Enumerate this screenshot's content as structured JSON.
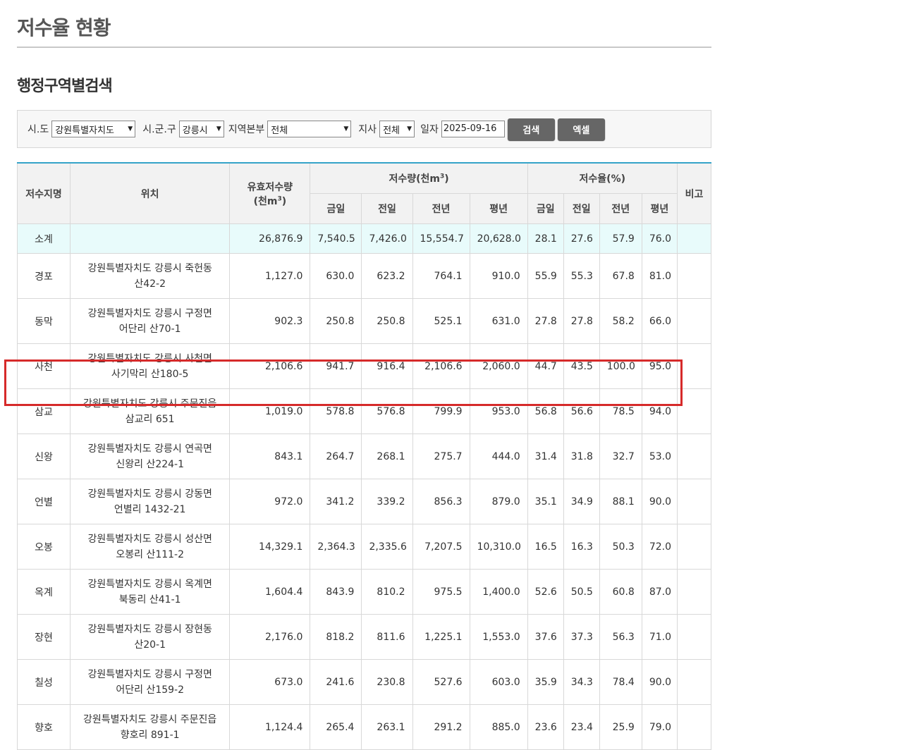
{
  "page_title": "저수율 현황",
  "section_title": "행정구역별검색",
  "search": {
    "sido_label": "시.도",
    "sido_value": "강원특별자치도",
    "sigungu_label": "시.군.구",
    "sigungu_value": "강릉시",
    "region_label": "지역본부",
    "region_value": "전체",
    "branch_label": "지사",
    "branch_value": "전체",
    "date_label": "일자",
    "date_value": "2025-09-16",
    "search_button": "검색",
    "excel_button": "엑셀"
  },
  "table": {
    "headers": {
      "name": "저수지명",
      "location": "위치",
      "effective_a": "유효저수량",
      "effective_b": "(천m",
      "effective_sup": "3",
      "effective_c": ")",
      "storage_a": "저수량(천m",
      "storage_sup": "3",
      "storage_c": ")",
      "rate": "저수율(%)",
      "remark": "비고",
      "today": "금일",
      "prev_day": "전일",
      "prev_year": "전년",
      "avg_year": "평년"
    },
    "summary": {
      "name": "소계",
      "location": "",
      "effective": "26,876.9",
      "s_today": "7,540.5",
      "s_prev_day": "7,426.0",
      "s_prev_year": "15,554.7",
      "s_avg": "20,628.0",
      "r_today": "28.1",
      "r_prev_day": "27.6",
      "r_prev_year": "57.9",
      "r_avg": "76.0",
      "remark": ""
    },
    "rows": [
      {
        "name": "경포",
        "loc1": "강원특별자치도 강릉시 죽헌동",
        "loc2": "산42-2",
        "effective": "1,127.0",
        "s_today": "630.0",
        "s_prev_day": "623.2",
        "s_prev_year": "764.1",
        "s_avg": "910.0",
        "r_today": "55.9",
        "r_prev_day": "55.3",
        "r_prev_year": "67.8",
        "r_avg": "81.0"
      },
      {
        "name": "동막",
        "loc1": "강원특별자치도 강릉시 구정면",
        "loc2": "어단리 산70-1",
        "effective": "902.3",
        "s_today": "250.8",
        "s_prev_day": "250.8",
        "s_prev_year": "525.1",
        "s_avg": "631.0",
        "r_today": "27.8",
        "r_prev_day": "27.8",
        "r_prev_year": "58.2",
        "r_avg": "66.0"
      },
      {
        "name": "사천",
        "loc1": "강원특별자치도 강릉시 사천면",
        "loc2": "사기막리 산180-5",
        "effective": "2,106.6",
        "s_today": "941.7",
        "s_prev_day": "916.4",
        "s_prev_year": "2,106.6",
        "s_avg": "2,060.0",
        "r_today": "44.7",
        "r_prev_day": "43.5",
        "r_prev_year": "100.0",
        "r_avg": "95.0"
      },
      {
        "name": "삼교",
        "loc1": "강원특별자치도 강릉시 주문진읍",
        "loc2": "삼교리 651",
        "effective": "1,019.0",
        "s_today": "578.8",
        "s_prev_day": "576.8",
        "s_prev_year": "799.9",
        "s_avg": "953.0",
        "r_today": "56.8",
        "r_prev_day": "56.6",
        "r_prev_year": "78.5",
        "r_avg": "94.0"
      },
      {
        "name": "신왕",
        "loc1": "강원특별자치도 강릉시 연곡면",
        "loc2": "신왕리 산224-1",
        "effective": "843.1",
        "s_today": "264.7",
        "s_prev_day": "268.1",
        "s_prev_year": "275.7",
        "s_avg": "444.0",
        "r_today": "31.4",
        "r_prev_day": "31.8",
        "r_prev_year": "32.7",
        "r_avg": "53.0"
      },
      {
        "name": "언별",
        "loc1": "강원특별자치도 강릉시 강동면",
        "loc2": "언별리 1432-21",
        "effective": "972.0",
        "s_today": "341.2",
        "s_prev_day": "339.2",
        "s_prev_year": "856.3",
        "s_avg": "879.0",
        "r_today": "35.1",
        "r_prev_day": "34.9",
        "r_prev_year": "88.1",
        "r_avg": "90.0"
      },
      {
        "name": "오봉",
        "loc1": "강원특별자치도 강릉시 성산면",
        "loc2": "오봉리 산111-2",
        "effective": "14,329.1",
        "s_today": "2,364.3",
        "s_prev_day": "2,335.6",
        "s_prev_year": "7,207.5",
        "s_avg": "10,310.0",
        "r_today": "16.5",
        "r_prev_day": "16.3",
        "r_prev_year": "50.3",
        "r_avg": "72.0"
      },
      {
        "name": "옥계",
        "loc1": "강원특별자치도 강릉시 옥계면",
        "loc2": "북동리 산41-1",
        "effective": "1,604.4",
        "s_today": "843.9",
        "s_prev_day": "810.2",
        "s_prev_year": "975.5",
        "s_avg": "1,400.0",
        "r_today": "52.6",
        "r_prev_day": "50.5",
        "r_prev_year": "60.8",
        "r_avg": "87.0"
      },
      {
        "name": "장현",
        "loc1": "강원특별자치도 강릉시 장현동",
        "loc2": "산20-1",
        "effective": "2,176.0",
        "s_today": "818.2",
        "s_prev_day": "811.6",
        "s_prev_year": "1,225.1",
        "s_avg": "1,553.0",
        "r_today": "37.6",
        "r_prev_day": "37.3",
        "r_prev_year": "56.3",
        "r_avg": "71.0"
      },
      {
        "name": "칠성",
        "loc1": "강원특별자치도 강릉시 구정면",
        "loc2": "어단리 산159-2",
        "effective": "673.0",
        "s_today": "241.6",
        "s_prev_day": "230.8",
        "s_prev_year": "527.6",
        "s_avg": "603.0",
        "r_today": "35.9",
        "r_prev_day": "34.3",
        "r_prev_year": "78.4",
        "r_avg": "90.0"
      },
      {
        "name": "향호",
        "loc1": "강원특별자치도 강릉시 주문진읍",
        "loc2": "향호리 891-1",
        "effective": "1,124.4",
        "s_today": "265.4",
        "s_prev_day": "263.1",
        "s_prev_year": "291.2",
        "s_avg": "885.0",
        "r_today": "23.6",
        "r_prev_day": "23.4",
        "r_prev_year": "25.9",
        "r_avg": "79.0"
      }
    ]
  },
  "colors": {
    "header_accent": "#35a3c8",
    "summary_bg": "#e8fbfb",
    "button_bg": "#666666",
    "highlight": "#d62a2a"
  }
}
